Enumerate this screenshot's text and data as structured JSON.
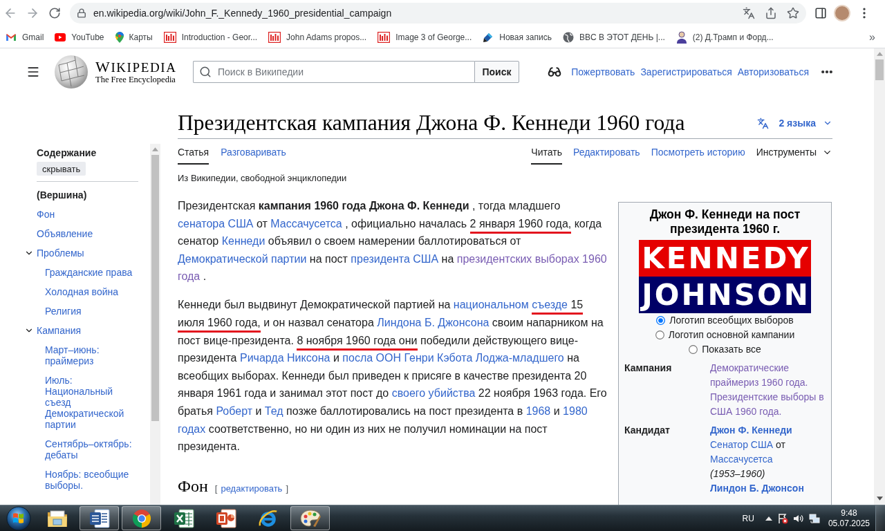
{
  "browser": {
    "url": "en.wikipedia.org/wiki/John_F._Kennedy_1960_presidential_campaign",
    "bookmarks": [
      {
        "kind": "gmail",
        "label": "Gmail"
      },
      {
        "kind": "youtube",
        "label": "YouTube"
      },
      {
        "kind": "maps",
        "label": "Карты"
      },
      {
        "kind": "loc",
        "label": "Introduction - Geor..."
      },
      {
        "kind": "loc",
        "label": "John Adams propos..."
      },
      {
        "kind": "loc",
        "label": "Image 3 of George..."
      },
      {
        "kind": "pen",
        "label": "Новая запись"
      },
      {
        "kind": "globe",
        "label": "BBC В ЭТОТ ДЕНЬ |..."
      },
      {
        "kind": "person",
        "label": "(2) Д.Трамп и Форд..."
      }
    ],
    "more": "»"
  },
  "wiki_header": {
    "wordmark": "WIKIPEDIA",
    "tagline": "The Free Encyclopedia",
    "search": {
      "placeholder": "Поиск в Википедии",
      "button": "Поиск"
    },
    "user_links": [
      "Пожертвовать",
      "Зарегистрироваться",
      "Авторизоваться"
    ]
  },
  "page": {
    "title": "Президентская кампания Джона Ф. Кеннеди 1960 года",
    "languages": "2 языка",
    "tabs_left": [
      {
        "label": "Статья",
        "selected": true
      },
      {
        "label": "Разговаривать",
        "selected": false
      }
    ],
    "tabs_right": [
      {
        "label": "Читать",
        "selected": true
      },
      {
        "label": "Редактировать",
        "selected": false
      },
      {
        "label": "Посмотреть историю",
        "selected": false
      }
    ],
    "tools": "Инструменты",
    "tagline": "Из Википедии, свободной энциклопедии"
  },
  "toc": {
    "heading": "Содержание",
    "hide_button": "скрывать",
    "items": [
      {
        "label": "(Вершина)",
        "selected": true
      },
      {
        "label": "Фон",
        "selected": false
      },
      {
        "label": "Объявление",
        "selected": false
      },
      {
        "label": "Проблемы",
        "selected": false,
        "expanded": true,
        "children": [
          {
            "label": "Гражданские права",
            "selected": false
          },
          {
            "label": "Холодная война",
            "selected": false
          },
          {
            "label": "Религия",
            "selected": false
          }
        ]
      },
      {
        "label": "Кампания",
        "selected": false,
        "expanded": true,
        "children": [
          {
            "label": "Март–июнь: праймериз",
            "selected": false
          },
          {
            "label": "Июль: Национальный съезд Демократической партии",
            "selected": false
          },
          {
            "label": "Сентябрь–октябрь: дебаты",
            "selected": false
          },
          {
            "label": "Ноябрь: всеобщие выборы.",
            "selected": false
          }
        ]
      }
    ]
  },
  "article": {
    "paragraphs": [
      {
        "segments": [
          {
            "kind": "text",
            "text": "Президентская ",
            "marked": false
          },
          {
            "kind": "bold",
            "text": "кампания 1960 года Джона Ф. Кеннеди",
            "marked": false
          },
          {
            "kind": "text",
            "text": " , тогда младшего ",
            "marked": false
          },
          {
            "kind": "link",
            "text": "сенатора США",
            "marked": false
          },
          {
            "kind": "text",
            "text": " от ",
            "marked": false
          },
          {
            "kind": "link",
            "text": "Массачусетса",
            "marked": false
          },
          {
            "kind": "text",
            "text": " , официально началась ",
            "marked": false
          },
          {
            "kind": "text",
            "text": "2 января 1960 года,",
            "marked": true
          },
          {
            "kind": "text",
            "text": " когда сенатор ",
            "marked": false
          },
          {
            "kind": "link",
            "text": "Кеннеди",
            "marked": false
          },
          {
            "kind": "text",
            "text": " объявил о своем намерении баллотироваться от ",
            "marked": false
          },
          {
            "kind": "link",
            "text": "Демократической партии",
            "marked": false
          },
          {
            "kind": "text",
            "text": " на пост ",
            "marked": false
          },
          {
            "kind": "link",
            "text": "президента США",
            "marked": false
          },
          {
            "kind": "text",
            "text": " на ",
            "marked": false
          },
          {
            "kind": "visited",
            "text": "президентских выборах 1960",
            "marked": false
          },
          {
            "kind": "visited",
            "text": " года",
            "marked": false
          },
          {
            "kind": "text",
            "text": " .",
            "marked": false
          }
        ]
      },
      {
        "segments": [
          {
            "kind": "text",
            "text": "Кеннеди был выдвинут Демократической партией на ",
            "marked": false
          },
          {
            "kind": "link",
            "text": "национальном ",
            "marked": false
          },
          {
            "kind": "link",
            "text": "съезде",
            "marked": true
          },
          {
            "kind": "text",
            "text": " 15 июля 1960 года,",
            "marked": true
          },
          {
            "kind": "text",
            "text": " и он назвал сенатора ",
            "marked": false
          },
          {
            "kind": "link",
            "text": "Линдона Б. Джонсона",
            "marked": false
          },
          {
            "kind": "text",
            "text": " своим напарником на пост вице-президента. ",
            "marked": false
          },
          {
            "kind": "text",
            "text": "8 ноября 1960 года они",
            "marked": true
          },
          {
            "kind": "text",
            "text": " победили действующего вице-президента ",
            "marked": false
          },
          {
            "kind": "link",
            "text": "Ричарда Никсона",
            "marked": false
          },
          {
            "kind": "text",
            "text": " и ",
            "marked": false
          },
          {
            "kind": "link",
            "text": "посла ООН Генри Кэбота Лоджа-младшего",
            "marked": false
          },
          {
            "kind": "text",
            "text": " на всеобщих выборах. Кеннеди был приведен к присяге в качестве президента 20 января 1961 года и занимал этот пост до ",
            "marked": false
          },
          {
            "kind": "link",
            "text": "своего убийства",
            "marked": false
          },
          {
            "kind": "text",
            "text": " 22 ноября 1963 года. Его братья ",
            "marked": false
          },
          {
            "kind": "link",
            "text": "Роберт",
            "marked": false
          },
          {
            "kind": "text",
            "text": " и ",
            "marked": false
          },
          {
            "kind": "link",
            "text": "Тед",
            "marked": false
          },
          {
            "kind": "text",
            "text": " позже баллотировались на пост президента в ",
            "marked": false
          },
          {
            "kind": "link",
            "text": "1968",
            "marked": false
          },
          {
            "kind": "text",
            "text": " и ",
            "marked": false
          },
          {
            "kind": "link",
            "text": "1980",
            "marked": false
          },
          {
            "kind": "link",
            "text": " годах",
            "marked": false
          },
          {
            "kind": "text",
            "text": " соответственно, но ни один из них не получил номинации на пост президента.",
            "marked": false
          }
        ]
      }
    ],
    "sections": [
      {
        "heading": "Фон",
        "edit_open": "[",
        "edit_link": "редактировать",
        "edit_close": "]"
      }
    ]
  },
  "infobox": {
    "title": "Джон Ф. Кеннеди на пост президента 1960 г.",
    "logo": {
      "top": "KENNEDY",
      "bottom": "JOHNSON"
    },
    "logo_options": [
      {
        "label": "Логотип всеобщих выборов",
        "selected": true
      },
      {
        "label": "Логотип основной кампании",
        "selected": false
      },
      {
        "label": "Показать все",
        "selected": false
      }
    ],
    "rows": [
      {
        "label": "Кампания",
        "lines": [
          [
            {
              "kind": "visited",
              "text": "Демократические праймериз 1960 года."
            }
          ],
          [
            {
              "kind": "visited",
              "text": "Президентские выборы в США 1960 года."
            }
          ]
        ]
      },
      {
        "label": "Кандидат",
        "lines": [
          [
            {
              "kind": "bold_link",
              "text": "Джон Ф. Кеннеди"
            }
          ],
          [
            {
              "kind": "link",
              "text": "Сенатор США"
            },
            {
              "kind": "text",
              "text": " от "
            },
            {
              "kind": "link",
              "text": "Массачусетса"
            }
          ],
          [
            {
              "kind": "italic",
              "text": "(1953–1960)"
            }
          ],
          [
            {
              "kind": "bold_link",
              "text": "Линдон Б. Джонсон"
            }
          ]
        ]
      }
    ]
  },
  "taskbar": {
    "apps": [
      {
        "kind": "explorer",
        "open": false
      },
      {
        "kind": "word",
        "open": true
      },
      {
        "kind": "chrome",
        "open": true
      },
      {
        "kind": "excel",
        "open": false
      },
      {
        "kind": "powerpoint",
        "open": false
      },
      {
        "kind": "ie",
        "open": false
      },
      {
        "kind": "paint",
        "open": true
      }
    ],
    "language": "RU",
    "time": "9:48",
    "date": "05.07.2025"
  }
}
